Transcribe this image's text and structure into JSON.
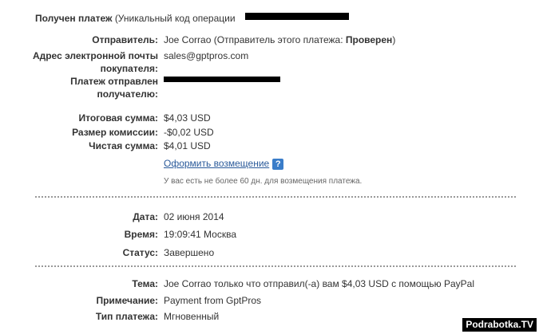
{
  "header": {
    "title": "Получен платеж",
    "subtitle": "(Уникальный код операции"
  },
  "sender": {
    "label": "Отправитель:",
    "name": "Joe Corrao (Отправитель этого платежа:",
    "status": "Проверен",
    "close": ")"
  },
  "email": {
    "label_line1": "Адрес электронной почты",
    "label_line2": "покупателя:",
    "value": "sales@gptpros.com"
  },
  "sent_to": {
    "label_line1": "Платеж отправлен",
    "label_line2": "получателю:"
  },
  "amounts": {
    "total_label": "Итоговая сумма:",
    "total_value": "$4,03 USD",
    "fee_label": "Размер комиссии:",
    "fee_value": "-$0,02 USD",
    "net_label": "Чистая сумма:",
    "net_value": "$4,01 USD"
  },
  "refund": {
    "link": "Оформить возмещение",
    "help": "?",
    "note": "У вас есть не более 60 дн. для возмещения платежа."
  },
  "details": {
    "date_label": "Дата:",
    "date_value": "02 июня 2014",
    "time_label": "Время:",
    "time_value": "19:09:41 Москва",
    "status_label": "Статус:",
    "status_value": "Завершено"
  },
  "message": {
    "subject_label": "Тема:",
    "subject_value": "Joe Corrao только что отправил(-а) вам $4,03 USD с помощью PayPal",
    "note_label": "Примечание:",
    "note_value": "Payment from GptPros",
    "type_label": "Тип платежа:",
    "type_value": "Мгновенный"
  },
  "watermark": "Podrabotka.TV"
}
